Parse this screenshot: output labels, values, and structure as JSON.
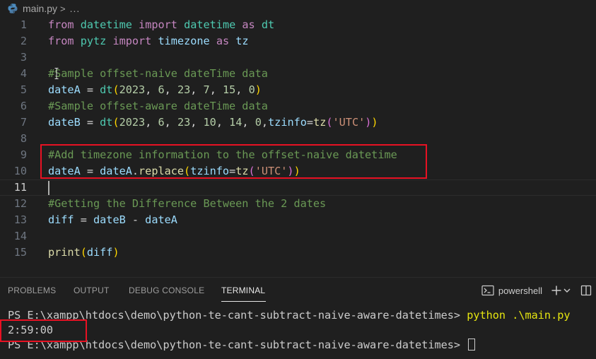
{
  "breadcrumb": {
    "file": "main.py",
    "separator": ">",
    "ellipsis": "..."
  },
  "editor": {
    "current_line": 11,
    "lines": [
      {
        "n": "1",
        "tokens": [
          [
            "kw",
            "from"
          ],
          [
            "pn",
            " "
          ],
          [
            "cls",
            "datetime"
          ],
          [
            "pn",
            " "
          ],
          [
            "kw",
            "import"
          ],
          [
            "pn",
            " "
          ],
          [
            "cls",
            "datetime"
          ],
          [
            "pn",
            " "
          ],
          [
            "kw",
            "as"
          ],
          [
            "pn",
            " "
          ],
          [
            "cls",
            "dt"
          ]
        ]
      },
      {
        "n": "2",
        "tokens": [
          [
            "kw",
            "from"
          ],
          [
            "pn",
            " "
          ],
          [
            "cls",
            "pytz"
          ],
          [
            "pn",
            " "
          ],
          [
            "kw",
            "import"
          ],
          [
            "pn",
            " "
          ],
          [
            "var",
            "timezone"
          ],
          [
            "pn",
            " "
          ],
          [
            "kw",
            "as"
          ],
          [
            "pn",
            " "
          ],
          [
            "var",
            "tz"
          ]
        ]
      },
      {
        "n": "3",
        "tokens": []
      },
      {
        "n": "4",
        "tokens": [
          [
            "cmt",
            "#Sample offset-naive dateTime data"
          ]
        ]
      },
      {
        "n": "5",
        "tokens": [
          [
            "var",
            "dateA"
          ],
          [
            "pn",
            " = "
          ],
          [
            "cls",
            "dt"
          ],
          [
            "b1",
            "("
          ],
          [
            "num",
            "2023"
          ],
          [
            "pn",
            ", "
          ],
          [
            "num",
            "6"
          ],
          [
            "pn",
            ", "
          ],
          [
            "num",
            "23"
          ],
          [
            "pn",
            ", "
          ],
          [
            "num",
            "7"
          ],
          [
            "pn",
            ", "
          ],
          [
            "num",
            "15"
          ],
          [
            "pn",
            ", "
          ],
          [
            "num",
            "0"
          ],
          [
            "b1",
            ")"
          ]
        ]
      },
      {
        "n": "6",
        "tokens": [
          [
            "cmt",
            "#Sample offset-aware dateTime data"
          ]
        ]
      },
      {
        "n": "7",
        "tokens": [
          [
            "var",
            "dateB"
          ],
          [
            "pn",
            " = "
          ],
          [
            "cls",
            "dt"
          ],
          [
            "b1",
            "("
          ],
          [
            "num",
            "2023"
          ],
          [
            "pn",
            ", "
          ],
          [
            "num",
            "6"
          ],
          [
            "pn",
            ", "
          ],
          [
            "num",
            "23"
          ],
          [
            "pn",
            ", "
          ],
          [
            "num",
            "10"
          ],
          [
            "pn",
            ", "
          ],
          [
            "num",
            "14"
          ],
          [
            "pn",
            ", "
          ],
          [
            "num",
            "0"
          ],
          [
            "pn",
            ","
          ],
          [
            "var",
            "tzinfo"
          ],
          [
            "pn",
            "="
          ],
          [
            "fn",
            "tz"
          ],
          [
            "b2",
            "("
          ],
          [
            "str",
            "'UTC'"
          ],
          [
            "b2",
            ")"
          ],
          [
            "b1",
            ")"
          ]
        ]
      },
      {
        "n": "8",
        "tokens": []
      },
      {
        "n": "9",
        "tokens": [
          [
            "cmt",
            "#Add timezone information to the offset-naive datetime"
          ]
        ]
      },
      {
        "n": "10",
        "tokens": [
          [
            "var",
            "dateA"
          ],
          [
            "pn",
            " = "
          ],
          [
            "var",
            "dateA"
          ],
          [
            "pn",
            "."
          ],
          [
            "fn",
            "replace"
          ],
          [
            "b1",
            "("
          ],
          [
            "var",
            "tzinfo"
          ],
          [
            "pn",
            "="
          ],
          [
            "fn",
            "tz"
          ],
          [
            "b2",
            "("
          ],
          [
            "str",
            "'UTC'"
          ],
          [
            "b2",
            ")"
          ],
          [
            "b1",
            ")"
          ]
        ]
      },
      {
        "n": "11",
        "tokens": []
      },
      {
        "n": "12",
        "tokens": [
          [
            "cmt",
            "#Getting the Difference Between the 2 dates"
          ]
        ]
      },
      {
        "n": "13",
        "tokens": [
          [
            "var",
            "diff"
          ],
          [
            "pn",
            " = "
          ],
          [
            "var",
            "dateB"
          ],
          [
            "pn",
            " - "
          ],
          [
            "var",
            "dateA"
          ]
        ]
      },
      {
        "n": "14",
        "tokens": []
      },
      {
        "n": "15",
        "tokens": [
          [
            "fn",
            "print"
          ],
          [
            "b1",
            "("
          ],
          [
            "var",
            "diff"
          ],
          [
            "b1",
            ")"
          ]
        ]
      }
    ]
  },
  "panel": {
    "tabs": [
      {
        "label": "PROBLEMS",
        "active": false
      },
      {
        "label": "OUTPUT",
        "active": false
      },
      {
        "label": "DEBUG CONSOLE",
        "active": false
      },
      {
        "label": "TERMINAL",
        "active": true
      }
    ],
    "shell_label": "powershell"
  },
  "terminal": {
    "prompt": "PS E:\\xampp\\htdocs\\demo\\python-te-cant-subtract-naive-aware-datetimes> ",
    "command": "python .\\main.py",
    "output": "2:59:00"
  },
  "colors": {
    "background": "#1f1f1f",
    "annotation_box": "#e81123",
    "keyword": "#c586c0",
    "class": "#4ec9b0",
    "variable": "#9cdcfe",
    "function": "#dcdcaa",
    "number": "#b5cea8",
    "string": "#ce9178",
    "comment": "#6a9955"
  },
  "icons": [
    "python-file-icon",
    "mouse-ibeam-icon",
    "powershell-icon",
    "plus-icon",
    "chevron-down-icon",
    "split-terminal-icon"
  ]
}
